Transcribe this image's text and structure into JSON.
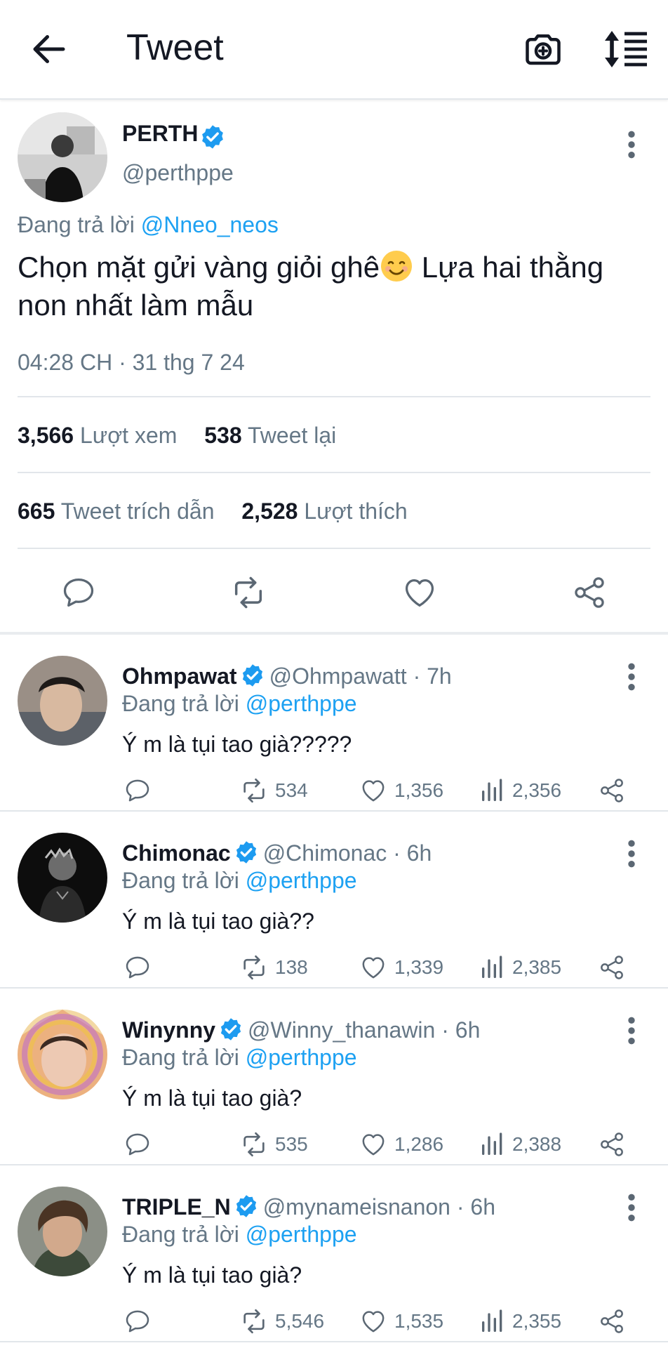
{
  "header": {
    "title": "Tweet",
    "colors": {
      "text": "#141823",
      "secondary": "#657786",
      "accent": "#1da1f2",
      "divider": "#e2e6ea"
    }
  },
  "main_tweet": {
    "name": "PERTH",
    "handle": "@perthppe",
    "reply_prefix": "Đang trả lời",
    "reply_to": "@Nneo_neos",
    "text_part1": "Chọn mặt gửi vàng giỏi ghê",
    "text_part2": " Lựa hai thằng non nhất làm mẫu",
    "emoji": "smiling-face-emoji",
    "timestamp": "04:28 CH · 31 thg 7 24",
    "views_count": "3,566",
    "views_label": "Lượt xem",
    "retweets_count": "538",
    "retweets_label": "Tweet lại",
    "quotes_count": "665",
    "quotes_label": "Tweet trích dẫn",
    "likes_count": "2,528",
    "likes_label": "Lượt thích"
  },
  "replies": [
    {
      "name": "Ohmpawat",
      "handle": "@Ohmpawatt",
      "time": "· 7h",
      "reply_prefix": "Đang trả lời",
      "reply_to": "@perthppe",
      "text": "Ý m là tụi tao già?????",
      "retweets": "534",
      "likes": "1,356",
      "views": "2,356"
    },
    {
      "name": "Chimonac",
      "handle": "@Chimonac",
      "time": "· 6h",
      "reply_prefix": "Đang trả lời",
      "reply_to": "@perthppe",
      "text": "Ý m là tụi tao già??",
      "retweets": "138",
      "likes": "1,339",
      "views": "2,385"
    },
    {
      "name": "Winynny",
      "handle": "@Winny_thanawin",
      "time": "· 6h",
      "reply_prefix": "Đang trả lời",
      "reply_to": "@perthppe",
      "text": "Ý m là tụi tao già?",
      "retweets": "535",
      "likes": "1,286",
      "views": "2,388"
    },
    {
      "name": "TRIPLE_N",
      "handle": "@mynameisnanon",
      "time": "· 6h",
      "reply_prefix": "Đang trả lời",
      "reply_to": "@perthppe",
      "text": "Ý m là tụi tao già?",
      "retweets": "5,546",
      "likes": "1,535",
      "views": "2,355"
    }
  ]
}
